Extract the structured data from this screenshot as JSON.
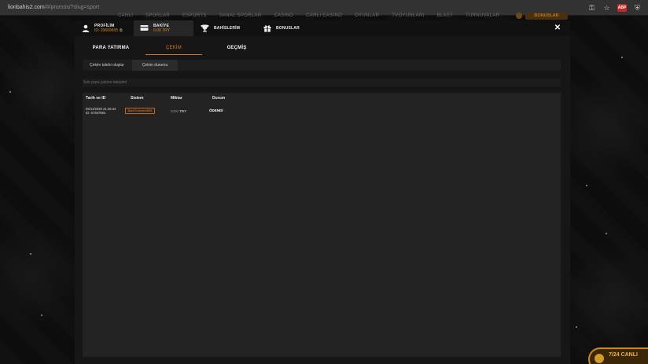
{
  "browser": {
    "url_host": "lionbahis2.com",
    "url_path": "/#/promos/?slug=sport",
    "back_icon": "arrow-left-icon",
    "forward_icon": "arrow-right-icon",
    "reload_icon": "reload-icon",
    "ext_badge": "ABP"
  },
  "site_nav": {
    "items": [
      "CANLI",
      "SPORLAR",
      "ESPORTS",
      "SANAL SPORLAR",
      "CASINO",
      "CANLI CASINO",
      "OYUNLAR",
      "TVOYUNLARI",
      "BLAST",
      "TURNUVALAR"
    ],
    "bonus_label": "BONUSLAR"
  },
  "modal": {
    "header": {
      "profile": {
        "title": "PROFİLİM",
        "id_text": "ID: 29669605"
      },
      "balance": {
        "title": "BAKİYE",
        "amount": "0.00 TRY"
      },
      "bets": {
        "title": "BAHİSLERİM"
      },
      "bonuses": {
        "title": "BONUSLAR"
      }
    },
    "tabs": [
      "PARA YATIRMA",
      "ÇEKİM",
      "GEÇMİŞ"
    ],
    "active_tab": "ÇEKİM",
    "subtabs": [
      "Çekim talebi oluştur",
      "Çekim durumu"
    ],
    "active_subtab": "Çekim durumu",
    "section_title": "Son para çekme talepleri",
    "table": {
      "headers": [
        "Tarih ve ID",
        "Sistem",
        "Miktar",
        "Durum"
      ],
      "rows": [
        {
          "date": "09/12/2020 21:46:44",
          "id": "ID: 67367584",
          "system": "BankTransferBMS",
          "amount_value": "5000",
          "amount_currency": "TRY",
          "status": "ÖDENDİ"
        }
      ]
    }
  },
  "live_support": {
    "label": "7/24 CANLI"
  },
  "colors": {
    "accent": "#d47428",
    "balance": "#d18b2a"
  }
}
